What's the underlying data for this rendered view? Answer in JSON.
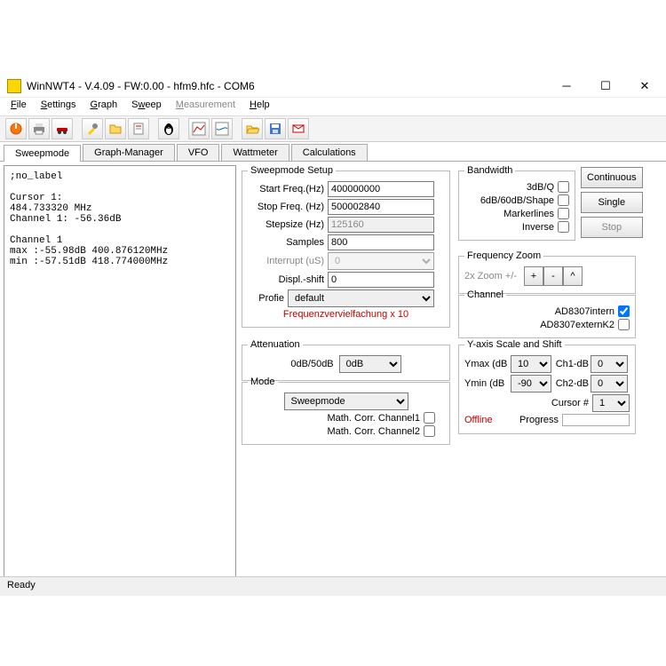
{
  "title": "WinNWT4 - V.4.09 - FW:0.00 - hfm9.hfc - COM6",
  "menu": {
    "file": "File",
    "settings": "Settings",
    "graph": "Graph",
    "sweep": "Sweep",
    "measurement": "Measurement",
    "help": "Help"
  },
  "tabs": {
    "sweepmode": "Sweepmode",
    "graphmgr": "Graph-Manager",
    "vfo": "VFO",
    "wattmeter": "Wattmeter",
    "calc": "Calculations"
  },
  "left_text": ";no_label\n\nCursor 1:\n484.733320 MHz\nChannel 1: -56.36dB\n\nChannel 1\nmax :-55.98dB 400.876120MHz\nmin :-57.51dB 418.774000MHz",
  "setup": {
    "legend": "Sweepmode Setup",
    "startfreq_l": "Start Freq.(Hz)",
    "startfreq_v": "400000000",
    "stopfreq_l": "Stop Freq. (Hz)",
    "stopfreq_v": "500002840",
    "stepsize_l": "Stepsize (Hz)",
    "stepsize_v": "125160",
    "samples_l": "Samples",
    "samples_v": "800",
    "interrupt_l": "Interrupt (uS)",
    "interrupt_v": "0",
    "displ_l": "Displ.-shift",
    "displ_v": "0",
    "profile_l": "Profie",
    "profile_v": "default",
    "freqmult": "Frequenzvervielfachung x 10"
  },
  "atten": {
    "legend": "Attenuation",
    "label": "0dB/50dB",
    "value": "0dB"
  },
  "mode": {
    "legend": "Mode",
    "value": "Sweepmode",
    "mc1": "Math. Corr. Channel1",
    "mc2": "Math. Corr. Channel2"
  },
  "bw": {
    "legend": "Bandwidth",
    "b1": "3dB/Q",
    "b2": "6dB/60dB/Shape",
    "b3": "Markerlines",
    "b4": "Inverse"
  },
  "ctrl": {
    "cont": "Continuous",
    "single": "Single",
    "stop": "Stop"
  },
  "zoom": {
    "legend": "Frequency Zoom",
    "label": "2x Zoom +/-",
    "plus": "+",
    "minus": "-",
    "caret": "^"
  },
  "channel": {
    "legend": "Channel",
    "c1": "AD8307intern",
    "c2": "AD8307externK2"
  },
  "yaxis": {
    "legend": "Y-axis Scale and Shift",
    "ymax_l": "Ymax (dB",
    "ymax_v": "10",
    "ch1_l": "Ch1-dB",
    "ch1_v": "0",
    "ymin_l": "Ymin (dB",
    "ymin_v": "-90",
    "ch2_l": "Ch2-dB",
    "ch2_v": "0",
    "cursor_l": "Cursor #",
    "cursor_v": "1",
    "offline": "Offline",
    "progress": "Progress"
  },
  "status": "Ready"
}
